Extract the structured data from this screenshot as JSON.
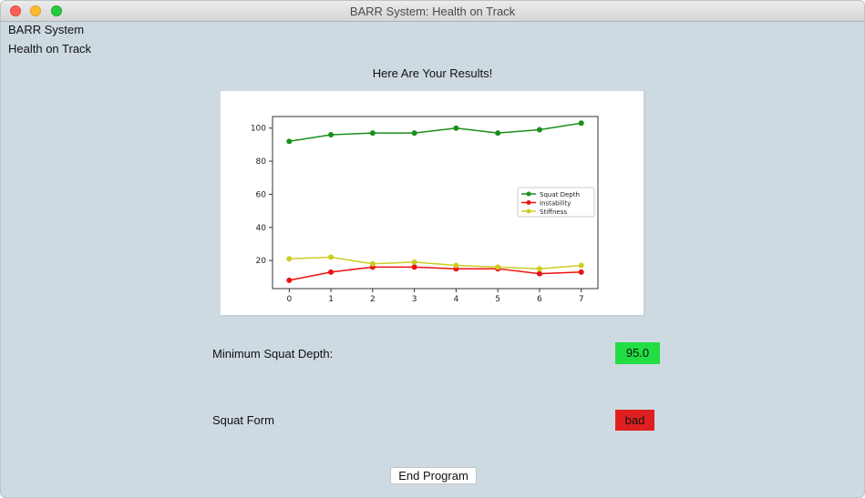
{
  "window": {
    "title": "BARR System: Health on Track",
    "controls": [
      "close-icon",
      "minimize-icon",
      "maximize-icon"
    ]
  },
  "header": {
    "app_name": "BARR System",
    "tagline": "Health on Track",
    "results_heading": "Here Are Your Results!"
  },
  "chart_data": {
    "type": "line",
    "title": "",
    "xlabel": "",
    "ylabel": "",
    "x": [
      0,
      1,
      2,
      3,
      4,
      5,
      6,
      7
    ],
    "xticks": [
      "0",
      "1",
      "2",
      "3",
      "4",
      "5",
      "6",
      "7"
    ],
    "yticks": [
      "20",
      "40",
      "60",
      "80",
      "100"
    ],
    "xlim": [
      -0.4,
      7.4
    ],
    "ylim": [
      3,
      107
    ],
    "grid": false,
    "legend_position": "right",
    "series": [
      {
        "name": "Squat Depth",
        "color": "#1a8f1a",
        "values": [
          92,
          96,
          97,
          97,
          100,
          97,
          99,
          103
        ]
      },
      {
        "name": "Instability",
        "color": "#ee1111",
        "values": [
          8,
          13,
          16,
          16,
          15,
          15,
          12,
          13
        ]
      },
      {
        "name": "Stiffness",
        "color": "#cccc22",
        "values": [
          21,
          22,
          18,
          19,
          17,
          16,
          15,
          17
        ]
      }
    ]
  },
  "results": {
    "min_depth_label": "Minimum Squat Depth:",
    "min_depth_value": "95.0",
    "min_depth_color": "#22dd44",
    "form_label": "Squat Form",
    "form_value": "bad",
    "form_color": "#e02020"
  },
  "actions": {
    "end_label": "End Program"
  }
}
